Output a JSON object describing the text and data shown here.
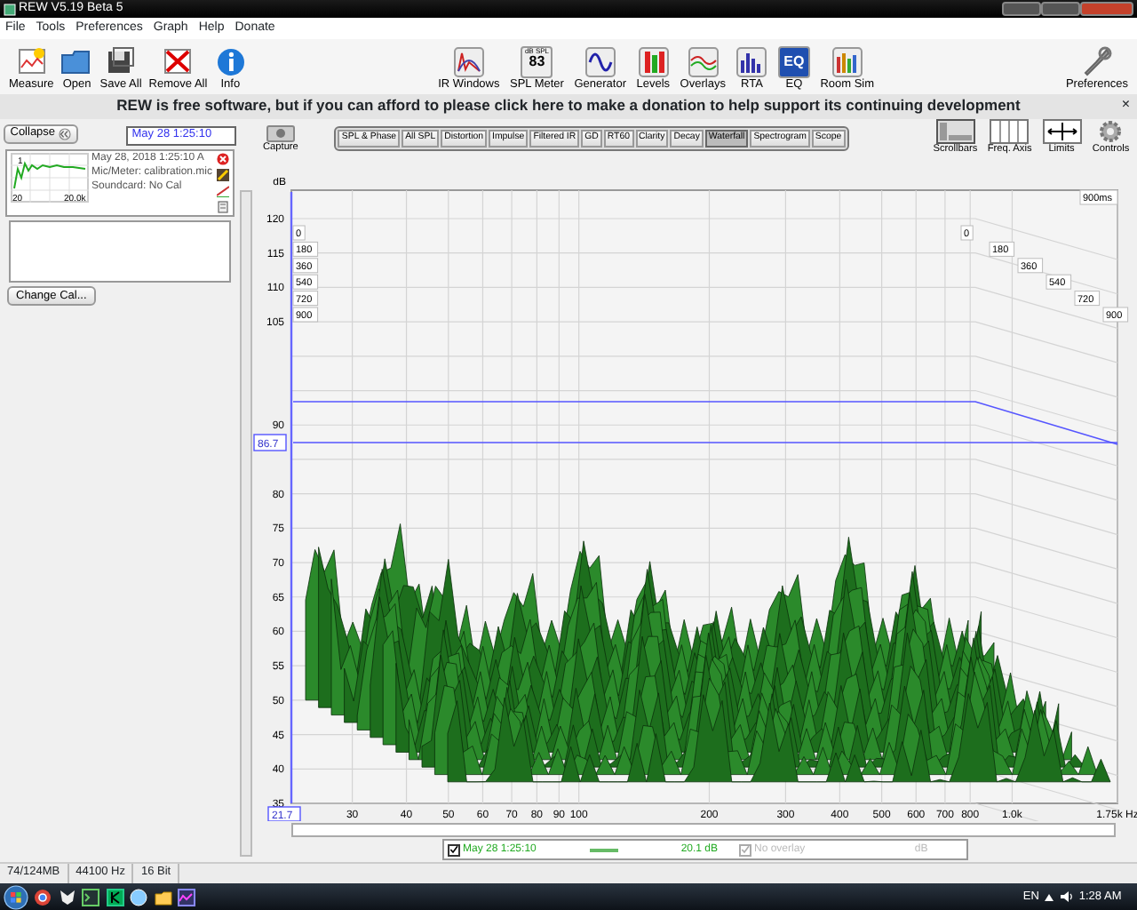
{
  "window": {
    "title": "REW V5.19 Beta 5"
  },
  "menu": [
    "File",
    "Tools",
    "Preferences",
    "Graph",
    "Help",
    "Donate"
  ],
  "toolbar_left": [
    {
      "label": "Measure"
    },
    {
      "label": "Open"
    },
    {
      "label": "Save All"
    },
    {
      "label": "Remove All"
    },
    {
      "label": "Info"
    }
  ],
  "toolbar_center": [
    {
      "label": "IR Windows"
    },
    {
      "label": "SPL Meter",
      "caption": "dB SPL",
      "display": "83"
    },
    {
      "label": "Generator"
    },
    {
      "label": "Levels"
    },
    {
      "label": "Overlays"
    },
    {
      "label": "RTA"
    },
    {
      "label": "EQ",
      "display": "EQ"
    },
    {
      "label": "Room Sim"
    }
  ],
  "toolbar_right": [
    {
      "label": "Preferences"
    }
  ],
  "banner": {
    "text_before": "REW is free software, but if you can afford to please",
    "link": "click here",
    "text_after": "to make a donation to help support its continuing development",
    "close": "×"
  },
  "measurement_panel": {
    "collapse": "Collapse",
    "name": "May 28 1:25:10",
    "thumbnail": {
      "y_label": "1",
      "x_start": "20",
      "x_end": "20.0k"
    },
    "details": [
      "May 28, 2018 1:25:10 A",
      "Mic/Meter: calibration.mic",
      "Soundcard: No Cal"
    ],
    "change_cal": "Change Cal..."
  },
  "graph": {
    "capture": "Capture",
    "tabs": [
      {
        "label": "SPL & Phase",
        "selected": false
      },
      {
        "label": "All SPL",
        "selected": false
      },
      {
        "label": "Distortion",
        "selected": false
      },
      {
        "label": "Impulse",
        "selected": false
      },
      {
        "label": "Filtered IR",
        "selected": false
      },
      {
        "label": "GD",
        "selected": false
      },
      {
        "label": "RT60",
        "selected": false
      },
      {
        "label": "Clarity",
        "selected": false
      },
      {
        "label": "Decay",
        "selected": false
      },
      {
        "label": "Waterfall",
        "selected": true
      },
      {
        "label": "Spectrogram",
        "selected": false
      },
      {
        "label": "Scope",
        "selected": false
      }
    ],
    "tools": [
      {
        "label": "Scrollbars"
      },
      {
        "label": "Freq. Axis"
      },
      {
        "label": "Limits"
      },
      {
        "label": "Controls"
      }
    ],
    "y_unit": "dB",
    "y_ticks": [
      "120",
      "115",
      "110",
      "105",
      "90",
      "80",
      "75",
      "70",
      "65",
      "60",
      "55",
      "50",
      "45",
      "40",
      "35"
    ],
    "x_start": "21.7",
    "x_ticks": [
      "30",
      "40",
      "50",
      "60",
      "70",
      "80",
      "90",
      "100",
      "200",
      "300",
      "400",
      "500",
      "600",
      "700",
      "800",
      "1.0k",
      "1.75k Hz"
    ],
    "cursor_level": "86.7",
    "time_labels_front": [
      "0",
      "180",
      "360",
      "540",
      "720",
      "900"
    ],
    "time_labels_back": [
      "0",
      "180",
      "360",
      "540",
      "720",
      "900"
    ],
    "time_end": "900ms"
  },
  "legend": {
    "trace": {
      "checked": true,
      "name": "May 28 1:25:10",
      "value": "20.1 dB"
    },
    "overlay": {
      "checked": true,
      "disabled": true,
      "name": "No overlay",
      "unit": "dB"
    }
  },
  "status_bar": [
    "74/124MB",
    "44100 Hz",
    "16 Bit"
  ],
  "taskbar": {
    "language": "EN",
    "clock": "1:28 AM"
  }
}
